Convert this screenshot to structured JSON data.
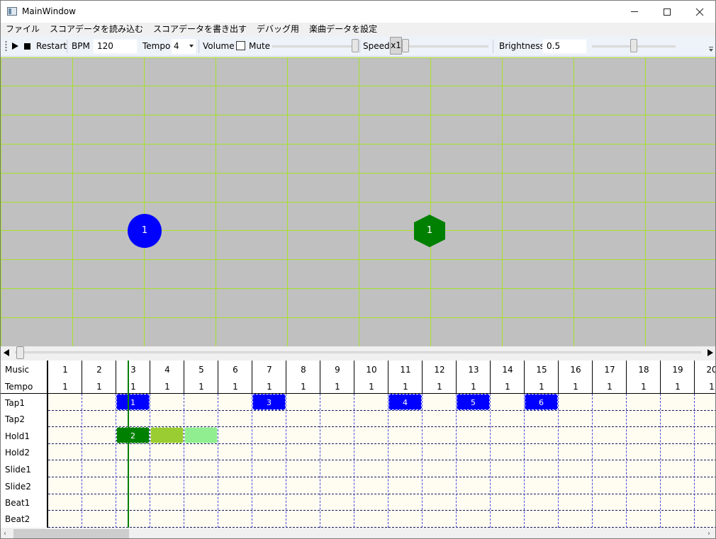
{
  "window": {
    "title": "MainWindow"
  },
  "menu": [
    "ファイル",
    "スコアデータを読み込む",
    "スコアデータを書き出す",
    "デバッグ用",
    "楽曲データを設定"
  ],
  "toolbar": {
    "restart_label": "Restart",
    "bpm_label": "BPM",
    "bpm_value": "120",
    "tempo_label": "Tempo",
    "tempo_value": "4",
    "volume_label": "Volume",
    "volume_level": 0.97,
    "mute_label": "Mute",
    "mute_checked": false,
    "speed_label": "Speed",
    "speed_value": "x1",
    "speed_level": 0.0,
    "brightness_label": "Brightness",
    "brightness_value": "0.5",
    "brightness_level": 0.5
  },
  "canvas": {
    "background": "#c0c0c0",
    "grid_color": "#a6e02a",
    "notes": [
      {
        "shape": "circle",
        "label": "1",
        "color": "#0000ff"
      },
      {
        "shape": "hexagon",
        "label": "1",
        "color": "#008000"
      }
    ]
  },
  "seek": {
    "position": 0.0
  },
  "timeline": {
    "header_labels": [
      "Music",
      "Tempo"
    ],
    "music_numbers": [
      "1",
      "2",
      "3",
      "4",
      "5",
      "6",
      "7",
      "8",
      "9",
      "10",
      "11",
      "12",
      "13",
      "14",
      "15",
      "16",
      "17",
      "18",
      "19",
      "20"
    ],
    "tempo_values": [
      "1",
      "1",
      "1",
      "1",
      "1",
      "1",
      "1",
      "1",
      "1",
      "1",
      "1",
      "1",
      "1",
      "1",
      "1",
      "1",
      "1",
      "1",
      "1",
      "1"
    ],
    "lanes": [
      "Tap1",
      "Tap2",
      "Hold1",
      "Hold2",
      "Slide1",
      "Slide2",
      "Beat1",
      "Beat2"
    ],
    "notes": [
      {
        "lane": 0,
        "col": 2,
        "label": "1",
        "color": "#0000ff"
      },
      {
        "lane": 0,
        "col": 6,
        "label": "3",
        "color": "#0000ff"
      },
      {
        "lane": 0,
        "col": 10,
        "label": "4",
        "color": "#0000ff"
      },
      {
        "lane": 0,
        "col": 12,
        "label": "5",
        "color": "#0000ff"
      },
      {
        "lane": 0,
        "col": 14,
        "label": "6",
        "color": "#0000ff"
      },
      {
        "lane": 2,
        "col": 2,
        "label": "2",
        "color": "#008000"
      },
      {
        "lane": 2,
        "col": 3,
        "label": "",
        "color": "#9acd32"
      },
      {
        "lane": 2,
        "col": 4,
        "label": "",
        "color": "#90ee90"
      }
    ]
  }
}
